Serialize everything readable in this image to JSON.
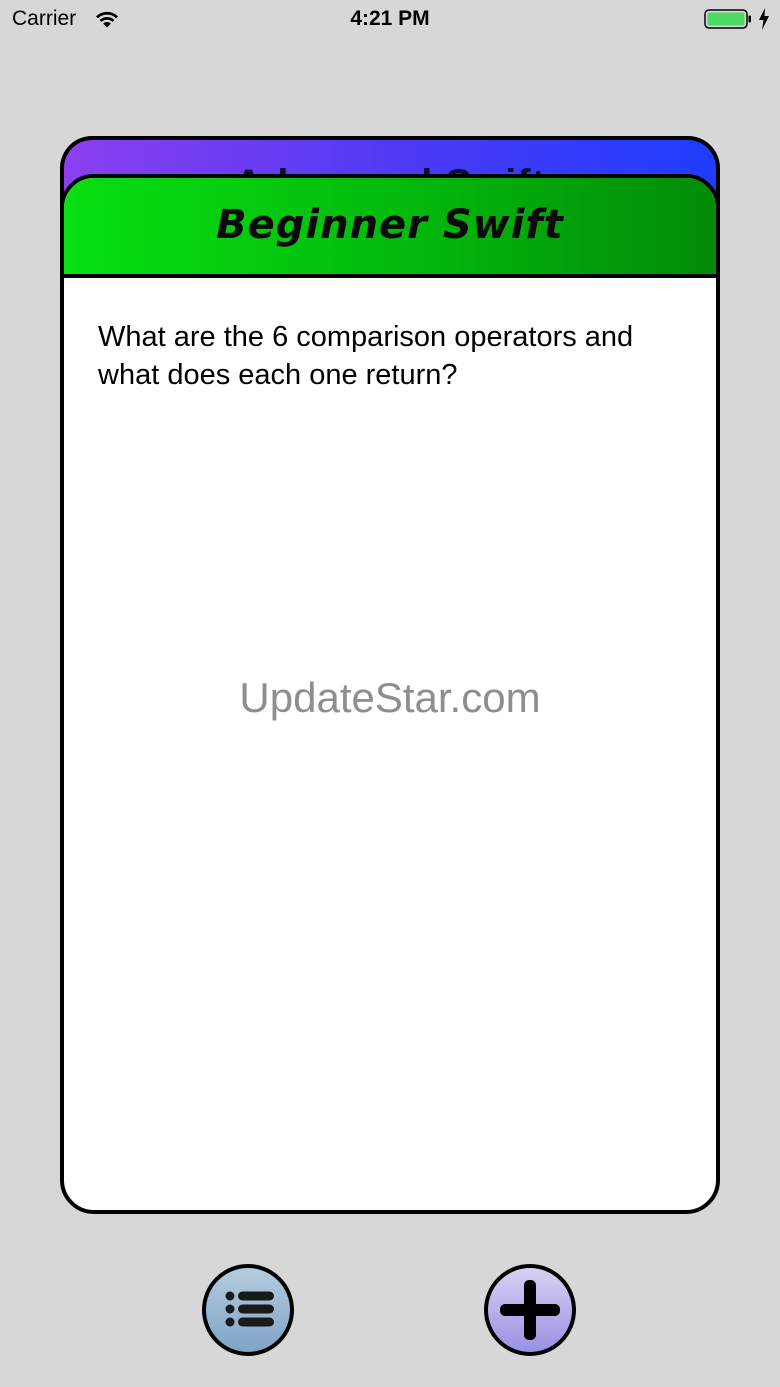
{
  "status_bar": {
    "carrier": "Carrier",
    "time": "4:21 PM",
    "wifi_icon": "wifi-icon",
    "battery_icon": "battery-charging-icon"
  },
  "back_card": {
    "title": "Advanced Swift",
    "color_start": "#8c3ff0",
    "color_end": "#1f3cff"
  },
  "front_card": {
    "title": "Beginner Swift",
    "question": "What are the 6 comparison operators and what does each one return?",
    "header_color": "#03b70c"
  },
  "watermark": "UpdateStar.com",
  "toolbar": {
    "list_button_icon": "list-icon",
    "add_button_icon": "plus-icon"
  }
}
